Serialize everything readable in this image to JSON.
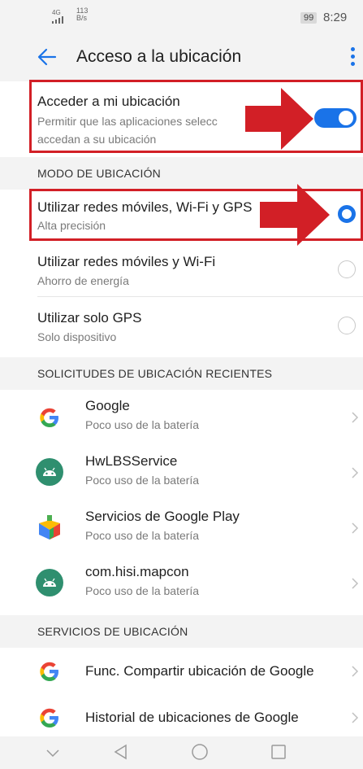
{
  "status": {
    "signal": "4G",
    "speed_value": "113",
    "speed_unit": "B/s",
    "battery": "99",
    "time": "8:29"
  },
  "header": {
    "title": "Acceso a la ubicación"
  },
  "access": {
    "title": "Acceder a mi ubicación",
    "subtitle_line1": "Permitir que las aplicaciones selecc",
    "subtitle_line2": "accedan a su ubicación",
    "enabled": true
  },
  "mode": {
    "section_label": "MODO DE UBICACIÓN",
    "options": [
      {
        "title": "Utilizar redes móviles, Wi-Fi y GPS",
        "subtitle": "Alta precisión",
        "selected": true
      },
      {
        "title": "Utilizar redes móviles y Wi-Fi",
        "subtitle": "Ahorro de energía",
        "selected": false
      },
      {
        "title": "Utilizar solo GPS",
        "subtitle": "Solo dispositivo",
        "selected": false
      }
    ]
  },
  "recent": {
    "section_label": "SOLICITUDES DE UBICACIÓN RECIENTES",
    "apps": [
      {
        "name": "Google",
        "usage": "Poco uso de la batería",
        "icon": "google-icon"
      },
      {
        "name": "HwLBSService",
        "usage": "Poco uso de la batería",
        "icon": "android-icon"
      },
      {
        "name": "Servicios de Google Play",
        "usage": "Poco uso de la batería",
        "icon": "play-services-icon"
      },
      {
        "name": "com.hisi.mapcon",
        "usage": "Poco uso de la batería",
        "icon": "android-icon"
      }
    ]
  },
  "services": {
    "section_label": "SERVICIOS DE UBICACIÓN",
    "items": [
      {
        "label": "Func. Compartir ubicación de Google",
        "icon": "google-icon"
      },
      {
        "label": "Historial de ubicaciones de Google",
        "icon": "google-icon"
      }
    ]
  },
  "nav": [
    "chevron-down-icon",
    "back-triangle-icon",
    "home-circle-icon",
    "recents-square-icon"
  ],
  "colors": {
    "accent": "#1a73e8",
    "highlight_red": "#d21f26",
    "android_green": "#2f8f6f"
  }
}
